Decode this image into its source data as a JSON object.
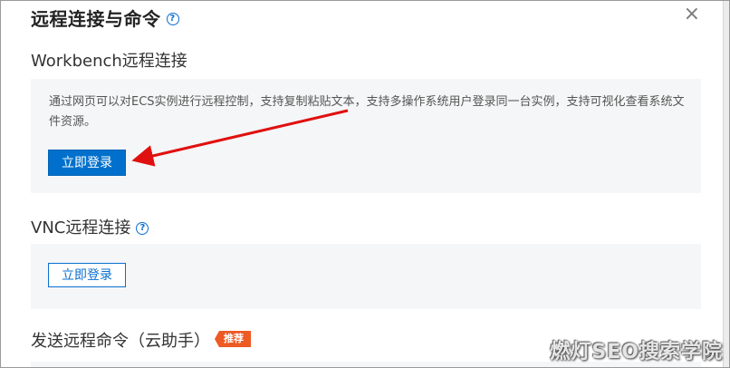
{
  "dialog": {
    "title": "远程连接与命令",
    "help_glyph": "?",
    "close_glyph": "×"
  },
  "workbench": {
    "title": "Workbench远程连接",
    "description": "通过网页可以对ECS实例进行远程控制，支持复制粘贴文本，支持多操作系统用户登录同一台实例，支持可视化查看系统文件资源。",
    "login_label": "立即登录"
  },
  "vnc": {
    "title": "VNC远程连接",
    "help_glyph": "?",
    "login_label": "立即登录"
  },
  "command": {
    "title": "发送远程命令（云助手）",
    "badge": "推荐"
  },
  "watermark": "燃灯SEO搜索学院",
  "colors": {
    "primary": "#0070cc",
    "link": "#0a6fd0",
    "badge": "#ee5a24",
    "arrow": "#e01010",
    "panel_bg": "#f5f6f7"
  }
}
